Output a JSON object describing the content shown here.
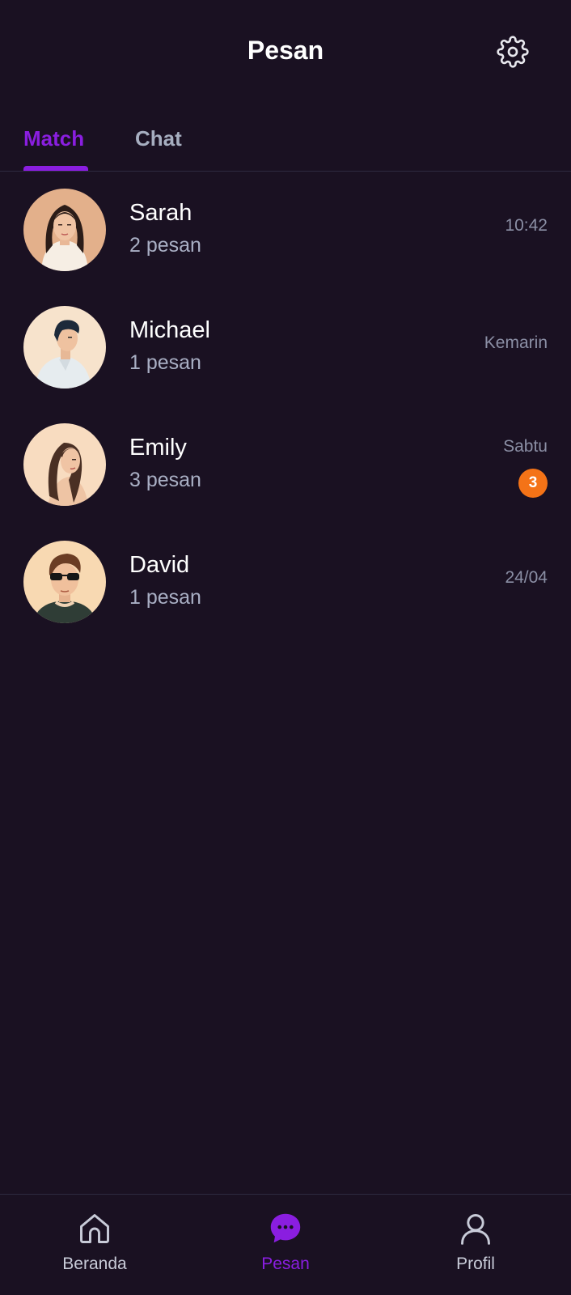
{
  "header": {
    "title": "Pesan",
    "settings_icon": "gear-icon"
  },
  "tabs": [
    {
      "label": "Match",
      "active": true
    },
    {
      "label": "Chat",
      "active": false
    }
  ],
  "conversations": [
    {
      "name": "Sarah",
      "subtitle": "2 pesan",
      "time": "10:42",
      "badge": null
    },
    {
      "name": "Michael",
      "subtitle": "1 pesan",
      "time": "Kemarin",
      "badge": null
    },
    {
      "name": "Emily",
      "subtitle": "3 pesan",
      "time": "Sabtu",
      "badge": "3"
    },
    {
      "name": "David",
      "subtitle": "1 pesan",
      "time": "24/04",
      "badge": null
    }
  ],
  "bottom_nav": [
    {
      "label": "Beranda",
      "icon": "home-icon",
      "active": false
    },
    {
      "label": "Pesan",
      "icon": "chat-bubble-icon",
      "active": true
    },
    {
      "label": "Profil",
      "icon": "person-icon",
      "active": false
    }
  ],
  "colors": {
    "background": "#1a1122",
    "accent": "#8a1ee0",
    "badge": "#f47317",
    "muted_text": "#a9afc4"
  }
}
